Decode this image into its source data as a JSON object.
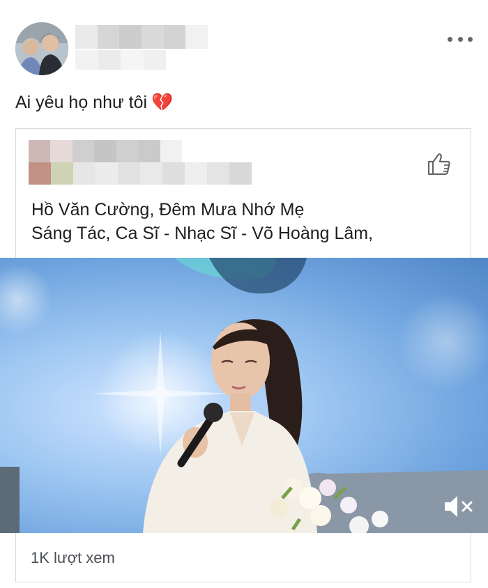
{
  "post": {
    "caption": "Ai yêu họ như tôi",
    "caption_emoji": "💔"
  },
  "shared": {
    "song_line_1": "Hồ Văn Cường, Đêm Mưa Nhớ Mẹ",
    "song_line_2": "Sáng Tác, Ca Sĩ - Nhạc Sĩ - Võ Hoàng Lâm,",
    "views": "1K lượt xem"
  },
  "icons": {
    "more": "more-dots-icon",
    "like": "thumbs-up-icon",
    "mute": "speaker-muted-icon"
  },
  "colors": {
    "text": "#1c1e21",
    "secondary": "#65676b",
    "border": "#d8dadf"
  }
}
